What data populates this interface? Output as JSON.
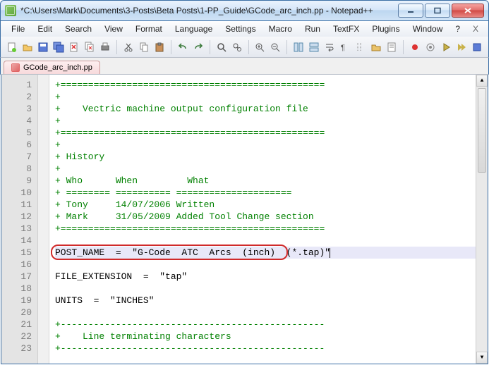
{
  "window": {
    "title": "*C:\\Users\\Mark\\Documents\\3-Posts\\Beta Posts\\1-PP_Guide\\GCode_arc_inch.pp - Notepad++"
  },
  "menus": {
    "file": "File",
    "edit": "Edit",
    "search": "Search",
    "view": "View",
    "format": "Format",
    "language": "Language",
    "settings": "Settings",
    "macro": "Macro",
    "run": "Run",
    "textfx": "TextFX",
    "plugins": "Plugins",
    "window": "Window",
    "help": "?",
    "x": "X"
  },
  "tab": {
    "name": "GCode_arc_inch.pp"
  },
  "lines": [
    {
      "n": 1,
      "cls": "green",
      "text": "+================================================"
    },
    {
      "n": 2,
      "cls": "green",
      "text": "+"
    },
    {
      "n": 3,
      "cls": "green",
      "text": "+    Vectric machine output configuration file"
    },
    {
      "n": 4,
      "cls": "green",
      "text": "+"
    },
    {
      "n": 5,
      "cls": "green",
      "text": "+================================================"
    },
    {
      "n": 6,
      "cls": "green",
      "text": "+"
    },
    {
      "n": 7,
      "cls": "green",
      "text": "+ History"
    },
    {
      "n": 8,
      "cls": "green",
      "text": "+"
    },
    {
      "n": 9,
      "cls": "green",
      "text": "+ Who      When         What"
    },
    {
      "n": 10,
      "cls": "green",
      "text": "+ ======== ========== ====================="
    },
    {
      "n": 11,
      "cls": "green",
      "text": "+ Tony     14/07/2006 Written"
    },
    {
      "n": 12,
      "cls": "green",
      "text": "+ Mark     31/05/2009 Added Tool Change section"
    },
    {
      "n": 13,
      "cls": "green",
      "text": "+================================================"
    },
    {
      "n": 14,
      "cls": "black",
      "text": ""
    },
    {
      "n": 15,
      "cls": "black",
      "text": "POST_NAME  =  \"G-Code  ATC  Arcs  (inch)  (*.tap)\"",
      "caret": true
    },
    {
      "n": 16,
      "cls": "black",
      "text": ""
    },
    {
      "n": 17,
      "cls": "black",
      "text": "FILE_EXTENSION  =  \"tap\""
    },
    {
      "n": 18,
      "cls": "black",
      "text": ""
    },
    {
      "n": 19,
      "cls": "black",
      "text": "UNITS  =  \"INCHES\""
    },
    {
      "n": 20,
      "cls": "black",
      "text": ""
    },
    {
      "n": 21,
      "cls": "green",
      "text": "+------------------------------------------------"
    },
    {
      "n": 22,
      "cls": "green",
      "text": "+    Line terminating characters"
    },
    {
      "n": 23,
      "cls": "green",
      "text": "+------------------------------------------------"
    }
  ],
  "icons": {
    "new": "new",
    "open": "open",
    "save": "save",
    "saveall": "saveall",
    "close": "close",
    "closeall": "closeall",
    "print": "print",
    "cut": "cut",
    "copy": "copy",
    "paste": "paste",
    "undo": "undo",
    "redo": "redo",
    "find": "find",
    "replace": "replace",
    "zoomin": "zoomin",
    "zoomout": "zoomout",
    "sync": "sync",
    "wrap": "wrap",
    "invis": "invis",
    "indent": "indent",
    "fold": "fold",
    "dir": "dir",
    "rec": "rec",
    "play": "play",
    "stop": "stop",
    "playrec": "playrec"
  }
}
